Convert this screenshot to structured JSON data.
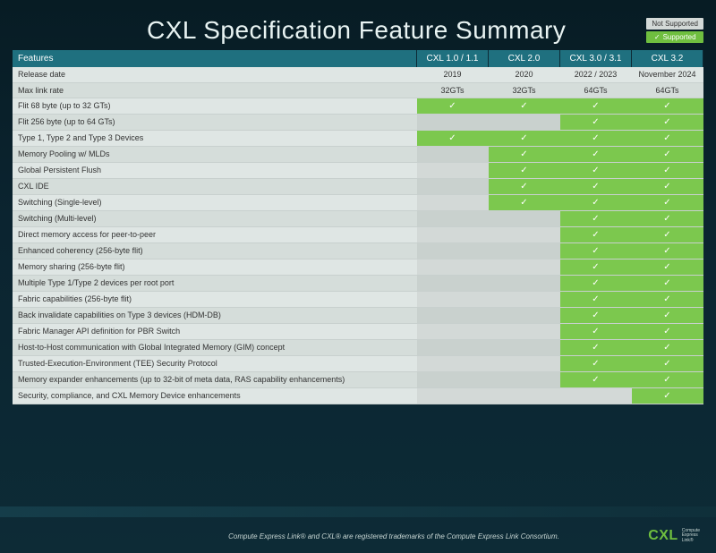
{
  "title": "CXL Specification Feature Summary",
  "legend": {
    "not_supported": "Not Supported",
    "supported": "Supported"
  },
  "columns": [
    "Features",
    "CXL 1.0 / 1.1",
    "CXL 2.0",
    "CXL 3.0 / 3.1",
    "CXL 3.2"
  ],
  "rows": [
    {
      "label": "Release date",
      "vals": [
        "2019",
        "2020",
        "2022 / 2023",
        "November 2024"
      ],
      "text": true
    },
    {
      "label": "Max link rate",
      "vals": [
        "32GTs",
        "32GTs",
        "64GTs",
        "64GTs"
      ],
      "text": true
    },
    {
      "label": "Flit 68 byte (up to 32 GTs)",
      "vals": [
        true,
        true,
        true,
        true
      ]
    },
    {
      "label": "Flit 256 byte (up to 64 GTs)",
      "vals": [
        false,
        false,
        true,
        true
      ]
    },
    {
      "label": "Type 1, Type 2 and Type 3 Devices",
      "vals": [
        true,
        true,
        true,
        true
      ]
    },
    {
      "label": "Memory Pooling w/ MLDs",
      "vals": [
        false,
        true,
        true,
        true
      ]
    },
    {
      "label": "Global Persistent Flush",
      "vals": [
        false,
        true,
        true,
        true
      ]
    },
    {
      "label": "CXL IDE",
      "vals": [
        false,
        true,
        true,
        true
      ]
    },
    {
      "label": "Switching (Single-level)",
      "vals": [
        false,
        true,
        true,
        true
      ]
    },
    {
      "label": "Switching (Multi-level)",
      "vals": [
        false,
        false,
        true,
        true
      ]
    },
    {
      "label": "Direct memory access for peer-to-peer",
      "vals": [
        false,
        false,
        true,
        true
      ]
    },
    {
      "label": "Enhanced coherency (256-byte flit)",
      "vals": [
        false,
        false,
        true,
        true
      ]
    },
    {
      "label": "Memory sharing (256-byte flit)",
      "vals": [
        false,
        false,
        true,
        true
      ]
    },
    {
      "label": "Multiple Type 1/Type 2 devices per root port",
      "vals": [
        false,
        false,
        true,
        true
      ]
    },
    {
      "label": "Fabric capabilities (256-byte flit)",
      "vals": [
        false,
        false,
        true,
        true
      ]
    },
    {
      "label": "Back invalidate capabilities on Type 3 devices (HDM-DB)",
      "vals": [
        false,
        false,
        true,
        true
      ]
    },
    {
      "label": "Fabric Manager API definition for PBR Switch",
      "vals": [
        false,
        false,
        true,
        true
      ]
    },
    {
      "label": "Host-to-Host communication with Global Integrated Memory (GIM) concept",
      "vals": [
        false,
        false,
        true,
        true
      ]
    },
    {
      "label": "Trusted-Execution-Environment (TEE) Security Protocol",
      "vals": [
        false,
        false,
        true,
        true
      ]
    },
    {
      "label": "Memory expander enhancements (up to 32-bit of meta data, RAS capability enhancements)",
      "vals": [
        false,
        false,
        true,
        true
      ]
    },
    {
      "label": "Security, compliance, and CXL Memory Device enhancements",
      "vals": [
        false,
        false,
        false,
        true
      ]
    }
  ],
  "footer": "Compute Express Link® and CXL® are registered trademarks of the Compute Express Link Consortium.",
  "logo": {
    "mark": "CXL",
    "sub1": "Compute",
    "sub2": "Express",
    "sub3": "Link®"
  }
}
